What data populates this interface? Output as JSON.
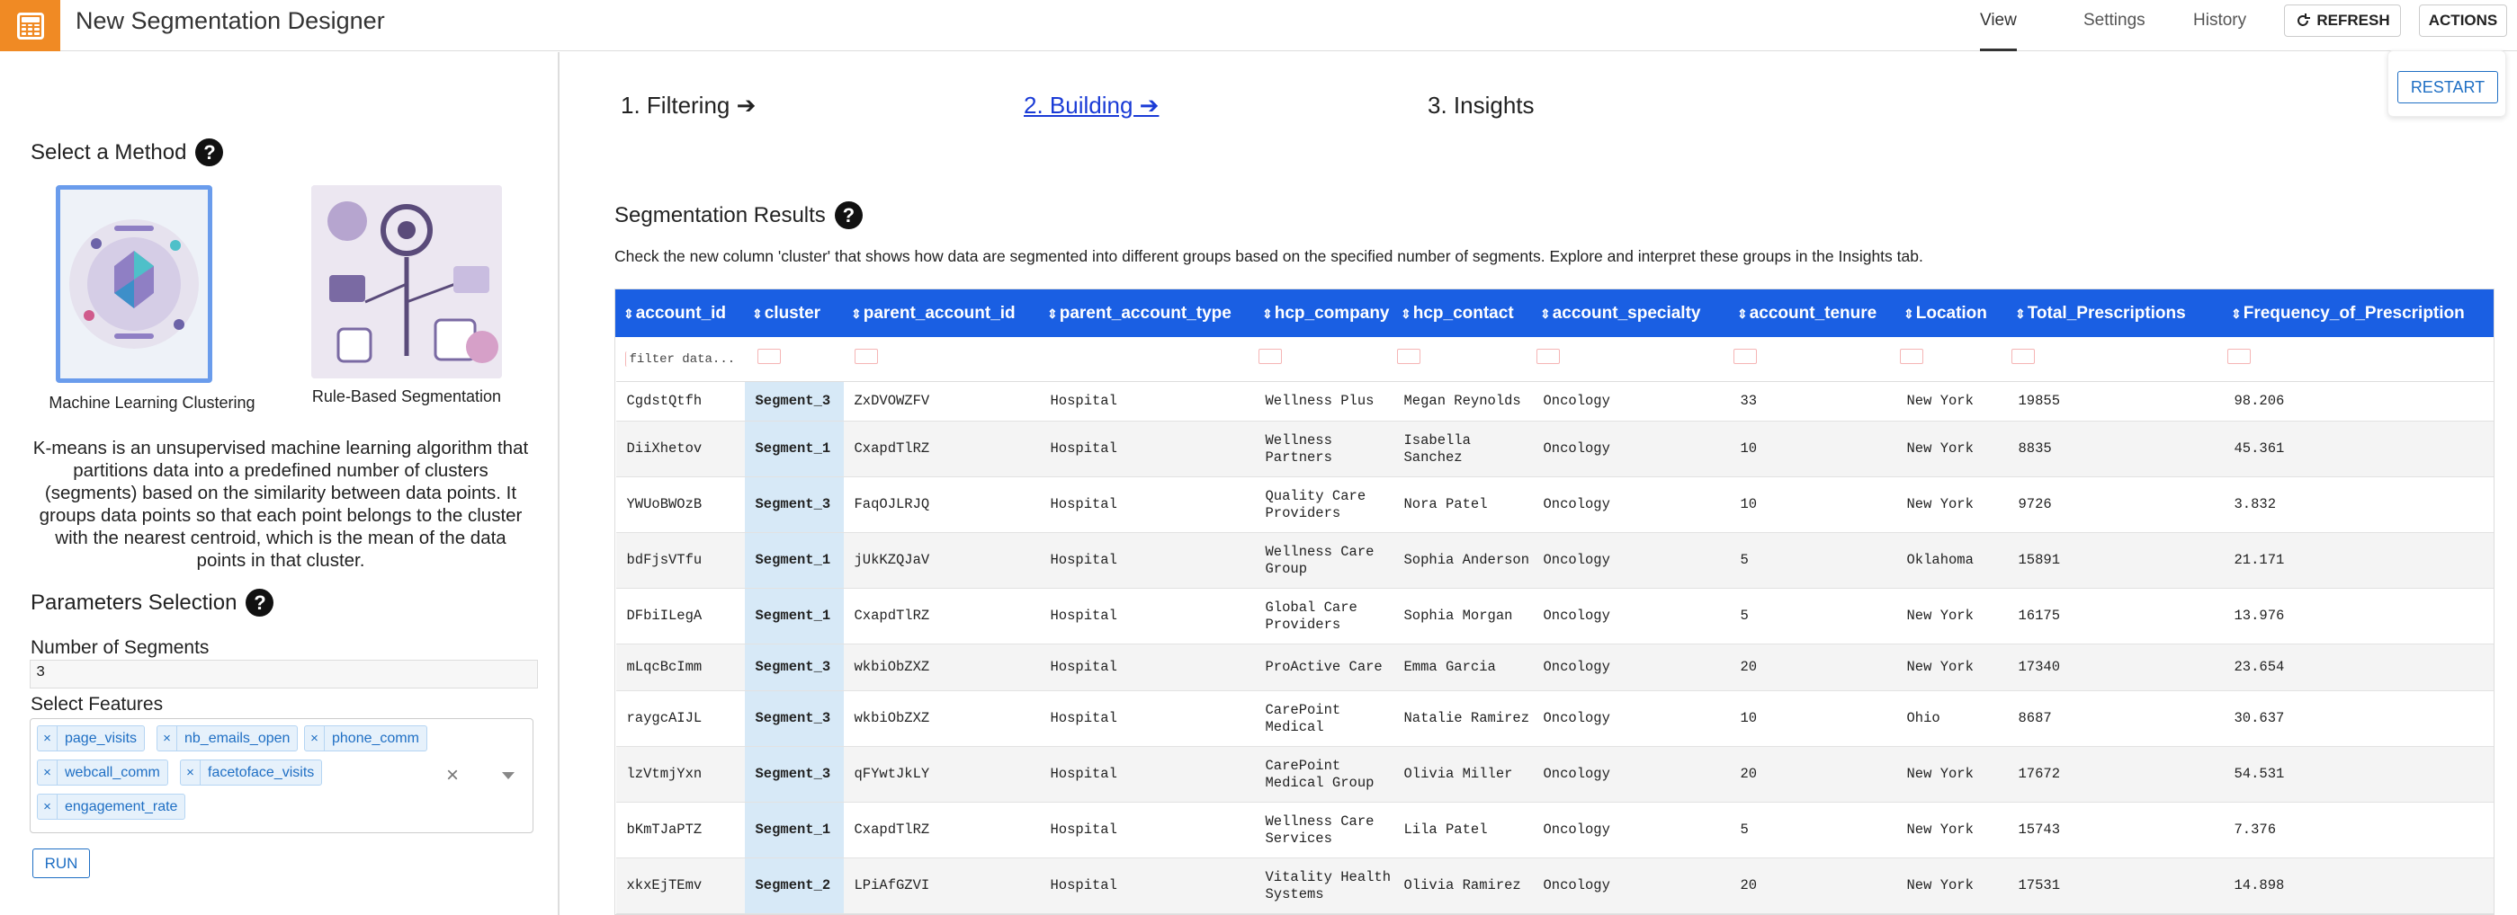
{
  "header": {
    "title": "New Segmentation Designer",
    "nav": [
      "View",
      "Settings",
      "History"
    ],
    "refresh_label": "REFRESH",
    "actions_label": "ACTIONS"
  },
  "left": {
    "method_title": "Select a Method",
    "methods": [
      {
        "label": "Machine Learning Clustering",
        "selected": true
      },
      {
        "label": "Rule-Based Segmentation",
        "selected": false
      }
    ],
    "description": "K-means is an unsupervised machine learning algorithm that partitions data into a predefined number of clusters (segments) based on the similarity between data points. It groups data points so that each point belongs to the cluster with the nearest centroid, which is the mean of the data points in that cluster.",
    "params_title": "Parameters Selection",
    "num_segments_label": "Number of Segments",
    "num_segments_value": "3",
    "features_label": "Select Features",
    "features": [
      "page_visits",
      "nb_emails_open",
      "phone_comm",
      "webcall_comm",
      "facetoface_visits",
      "engagement_rate"
    ],
    "run_label": "RUN"
  },
  "steps": [
    "1. Filtering ➔",
    "2. Building ➔",
    "3. Insights"
  ],
  "restart_label": "RESTART",
  "results": {
    "title": "Segmentation Results",
    "description": "Check the new column 'cluster' that shows how data are segmented into different groups based on the specified number of segments. Explore and interpret these groups in the Insights tab.",
    "filter_placeholder": "filter data...",
    "columns": [
      "account_id",
      "cluster",
      "parent_account_id",
      "parent_account_type",
      "hcp_company",
      "hcp_contact",
      "account_specialty",
      "account_tenure",
      "Location",
      "Total_Prescriptions",
      "Frequency_of_Prescription"
    ],
    "rows": [
      [
        "CgdstQtfh",
        "Segment_3",
        "ZxDVOWZFV",
        "Hospital",
        "Wellness Plus",
        "Megan Reynolds",
        "Oncology",
        "33",
        "New York",
        "19855",
        "98.206"
      ],
      [
        "DiiXhetov",
        "Segment_1",
        "CxapdTlRZ",
        "Hospital",
        "Wellness Partners",
        "Isabella Sanchez",
        "Oncology",
        "10",
        "New York",
        "8835",
        "45.361"
      ],
      [
        "YWUoBWOzB",
        "Segment_3",
        "FaqOJLRJQ",
        "Hospital",
        "Quality Care Providers",
        "Nora Patel",
        "Oncology",
        "10",
        "New York",
        "9726",
        "3.832"
      ],
      [
        "bdFjsVTfu",
        "Segment_1",
        "jUkKZQJaV",
        "Hospital",
        "Wellness Care Group",
        "Sophia Anderson",
        "Oncology",
        "5",
        "Oklahoma",
        "15891",
        "21.171"
      ],
      [
        "DFbiILegA",
        "Segment_1",
        "CxapdTlRZ",
        "Hospital",
        "Global Care Providers",
        "Sophia Morgan",
        "Oncology",
        "5",
        "New York",
        "16175",
        "13.976"
      ],
      [
        "mLqcBcImm",
        "Segment_3",
        "wkbiObZXZ",
        "Hospital",
        "ProActive Care",
        "Emma Garcia",
        "Oncology",
        "20",
        "New York",
        "17340",
        "23.654"
      ],
      [
        "raygcAIJL",
        "Segment_3",
        "wkbiObZXZ",
        "Hospital",
        "CarePoint Medical",
        "Natalie Ramirez",
        "Oncology",
        "10",
        "Ohio",
        "8687",
        "30.637"
      ],
      [
        "lzVtmjYxn",
        "Segment_3",
        "qFYwtJkLY",
        "Hospital",
        "CarePoint Medical Group",
        "Olivia Miller",
        "Oncology",
        "20",
        "New York",
        "17672",
        "54.531"
      ],
      [
        "bKmTJaPTZ",
        "Segment_1",
        "CxapdTlRZ",
        "Hospital",
        "Wellness Care Services",
        "Lila Patel",
        "Oncology",
        "5",
        "New York",
        "15743",
        "7.376"
      ],
      [
        "xkxEjTEmv",
        "Segment_2",
        "LPiAfGZVI",
        "Hospital",
        "Vitality Health Systems",
        "Olivia Ramirez",
        "Oncology",
        "20",
        "New York",
        "17531",
        "14.898"
      ]
    ]
  },
  "colors": {
    "accent": "#1a5fe3",
    "brand": "#f08a24",
    "cluster_bg": "#d7e9f7"
  }
}
